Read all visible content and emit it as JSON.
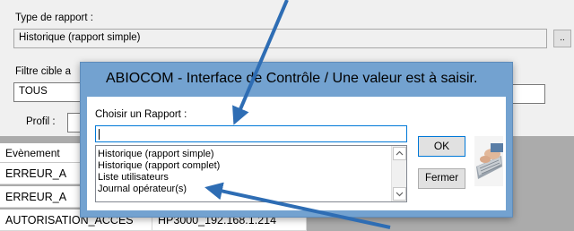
{
  "form": {
    "type_label": "Type de rapport :",
    "type_value": "Historique (rapport simple)",
    "dots_label": "..",
    "filter_label": "Filtre cible a",
    "filter_value": "TOUS",
    "profil_label": "Profil :"
  },
  "table": {
    "headers": [
      "Evènement"
    ],
    "rows": [
      [
        "ERREUR_A",
        ""
      ],
      [
        "ERREUR_A",
        ""
      ],
      [
        "AUTORISATION_ACCES",
        "HP3000_192.168.1.214"
      ]
    ]
  },
  "dialog": {
    "title": "ABIOCOM - Interface de Contrôle / Une valeur est à saisir.",
    "prompt": "Choisir un Rapport :",
    "input_value": "",
    "options": [
      "Historique (rapport simple)",
      "Historique (rapport complet)",
      "Liste utilisateurs",
      "Journal opérateur(s)"
    ],
    "ok_label": "OK",
    "cancel_label": "Fermer"
  },
  "colors": {
    "dialog_frame": "#73a2d0",
    "annotation_arrow": "#2e6db4",
    "focus_border": "#0078d7"
  },
  "icons": {
    "scroll_up": "chevron-up-icon",
    "scroll_down": "chevron-down-icon",
    "keyboard_image": "keyboard-icon"
  }
}
